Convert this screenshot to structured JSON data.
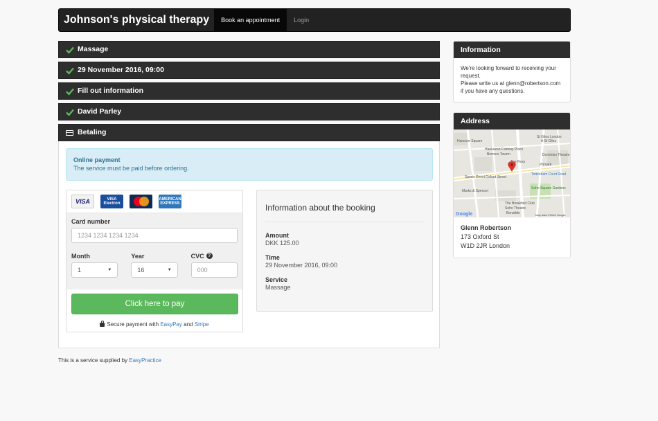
{
  "navbar": {
    "brand": "Johnson's physical therapy",
    "items": [
      {
        "label": "Book an appointment",
        "active": true
      },
      {
        "label": "Login",
        "active": false
      }
    ]
  },
  "steps": [
    {
      "label": "Massage",
      "icon": "check-icon"
    },
    {
      "label": "29 November 2016, 09:00",
      "icon": "check-icon"
    },
    {
      "label": "Fill out information",
      "icon": "check-icon"
    },
    {
      "label": "David Parley",
      "icon": "check-icon"
    },
    {
      "label": "Betaling",
      "icon": "credit-card-icon"
    }
  ],
  "alert": {
    "title": "Online payment",
    "text": "The service must be paid before ordering."
  },
  "card_form": {
    "logos": [
      "VISA",
      "VISA Electron",
      "MasterCard",
      "AMERICAN EXPRESS"
    ],
    "card_number_label": "Card number",
    "card_number_placeholder": "1234 1234 1234 1234",
    "month_label": "Month",
    "month_value": "1",
    "year_label": "Year",
    "year_value": "16",
    "cvc_label": "CVC",
    "cvc_placeholder": "000",
    "pay_button": "Click here to pay",
    "secure_prefix": "Secure payment with",
    "secure_link1": "EasyPay",
    "secure_and": "and",
    "secure_link2": "Stripe"
  },
  "booking": {
    "title": "Information about the booking",
    "amount_label": "Amount",
    "amount_value": "DKK 125.00",
    "time_label": "Time",
    "time_value": "29 November 2016, 09:00",
    "service_label": "Service",
    "service_value": "Massage"
  },
  "footer": {
    "prefix": "This is a service supplied by",
    "link": "EasyPractice"
  },
  "sidebar": {
    "info_title": "Information",
    "info_text1": "We're looking forward to receiving your request.",
    "info_text2": "Please write us at glenn@robertson.com if you have any questions.",
    "address_title": "Address",
    "name": "Glenn Robertson",
    "street": "173 Oxford St",
    "city": "W1D 2JR London"
  },
  "map": {
    "labels": [
      "St Giles London",
      "A St Giles",
      "Hanover Square",
      "Hankazan Fairway Place",
      "Berners Tavern",
      "Dominion Theatre",
      "The Roxy",
      "Primark",
      "Tottenham Court Road",
      "Sports Direct Oxford Street",
      "Marks & Spencer",
      "Soho Square Gardens",
      "The Breakfast Club",
      "Soho Theatre",
      "Bonafide"
    ],
    "google": "Google",
    "copyright": "Map data ©2016 Google",
    "colors": {
      "park": "#c8e0b4",
      "road": "#ffffff",
      "pin": "#d9362b"
    }
  },
  "colors": {
    "navbar": "#222222",
    "step_bar": "#2e2e2e",
    "check": "#5cb85c",
    "pay_button": "#5cb85c",
    "alert_bg": "#d9edf7",
    "link": "#337ab7"
  }
}
